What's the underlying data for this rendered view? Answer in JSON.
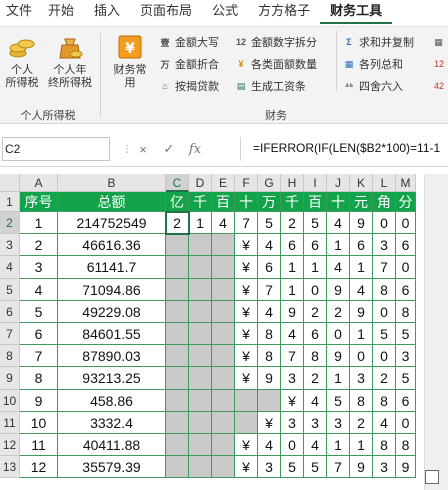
{
  "ribbon_tabs": [
    "文件",
    "开始",
    "插入",
    "页面布局",
    "公式",
    "方方格子",
    "财务工具"
  ],
  "active_tab_index": 6,
  "ribbon": {
    "group1": {
      "label": "个人所得税",
      "btn1": "个人\n所得税",
      "btn2": "个人年\n终所得税"
    },
    "group2": {
      "label": "财务",
      "big_btn": "财务常\n用",
      "col1": [
        "金额大写",
        "金额折合",
        "按揭贷款"
      ],
      "col2": [
        "金额数字拆分",
        "各类面额数量",
        "生成工资条"
      ],
      "col3": [
        "求和并复制",
        "各列总和",
        "四舍六入"
      ],
      "col3_icons": [
        "万",
        "12",
        "¥"
      ],
      "col4_fragments": [
        "",
        "12",
        "42"
      ]
    }
  },
  "formula_bar": {
    "name_box": "C2",
    "cancel_icon": "×",
    "enter_icon": "✓",
    "fx": "fx",
    "formula": "=IFERROR(IF(LEN($B2*100)=11-1"
  },
  "grid": {
    "columns": [
      "A",
      "B",
      "C",
      "D",
      "E",
      "F",
      "G",
      "H",
      "I",
      "J",
      "K",
      "L",
      "M"
    ],
    "selected_column": "C",
    "selected_row": "2",
    "row_numbers": [
      "1",
      "2",
      "3",
      "4",
      "5",
      "6",
      "7",
      "8",
      "9",
      "10",
      "11",
      "12",
      "13"
    ],
    "header_row": [
      "序号",
      "总额",
      "亿",
      "千",
      "百",
      "十",
      "万",
      "千",
      "百",
      "十",
      "元",
      "角",
      "分"
    ],
    "rows": [
      [
        "1",
        "214752549",
        "2",
        "1",
        "4",
        "7",
        "5",
        "2",
        "5",
        "4",
        "9",
        "0",
        "0"
      ],
      [
        "2",
        "46616.36",
        "",
        "",
        "",
        "¥",
        "4",
        "6",
        "6",
        "1",
        "6",
        "3",
        "6"
      ],
      [
        "3",
        "61141.7",
        "",
        "",
        "",
        "¥",
        "6",
        "1",
        "1",
        "4",
        "1",
        "7",
        "0"
      ],
      [
        "4",
        "71094.86",
        "",
        "",
        "",
        "¥",
        "7",
        "1",
        "0",
        "9",
        "4",
        "8",
        "6"
      ],
      [
        "5",
        "49229.08",
        "",
        "",
        "",
        "¥",
        "4",
        "9",
        "2",
        "2",
        "9",
        "0",
        "8"
      ],
      [
        "6",
        "84601.55",
        "",
        "",
        "",
        "¥",
        "8",
        "4",
        "6",
        "0",
        "1",
        "5",
        "5"
      ],
      [
        "7",
        "87890.03",
        "",
        "",
        "",
        "¥",
        "8",
        "7",
        "8",
        "9",
        "0",
        "0",
        "3"
      ],
      [
        "8",
        "93213.25",
        "",
        "",
        "",
        "¥",
        "9",
        "3",
        "2",
        "1",
        "3",
        "2",
        "5"
      ],
      [
        "9",
        "458.86",
        "",
        "",
        "",
        "",
        "",
        "¥",
        "4",
        "5",
        "8",
        "8",
        "6"
      ],
      [
        "10",
        "3332.4",
        "",
        "",
        "",
        "",
        "¥",
        "3",
        "3",
        "3",
        "2",
        "4",
        "0"
      ],
      [
        "11",
        "40411.88",
        "",
        "",
        "",
        "¥",
        "4",
        "0",
        "4",
        "1",
        "1",
        "8",
        "8"
      ],
      [
        "12",
        "35579.39",
        "",
        "",
        "",
        "¥",
        "3",
        "5",
        "5",
        "7",
        "9",
        "3",
        "9"
      ]
    ]
  },
  "colors": {
    "header_green": "#13a44b",
    "excel_green": "#217346",
    "gray_cell": "#c9c9c9"
  }
}
